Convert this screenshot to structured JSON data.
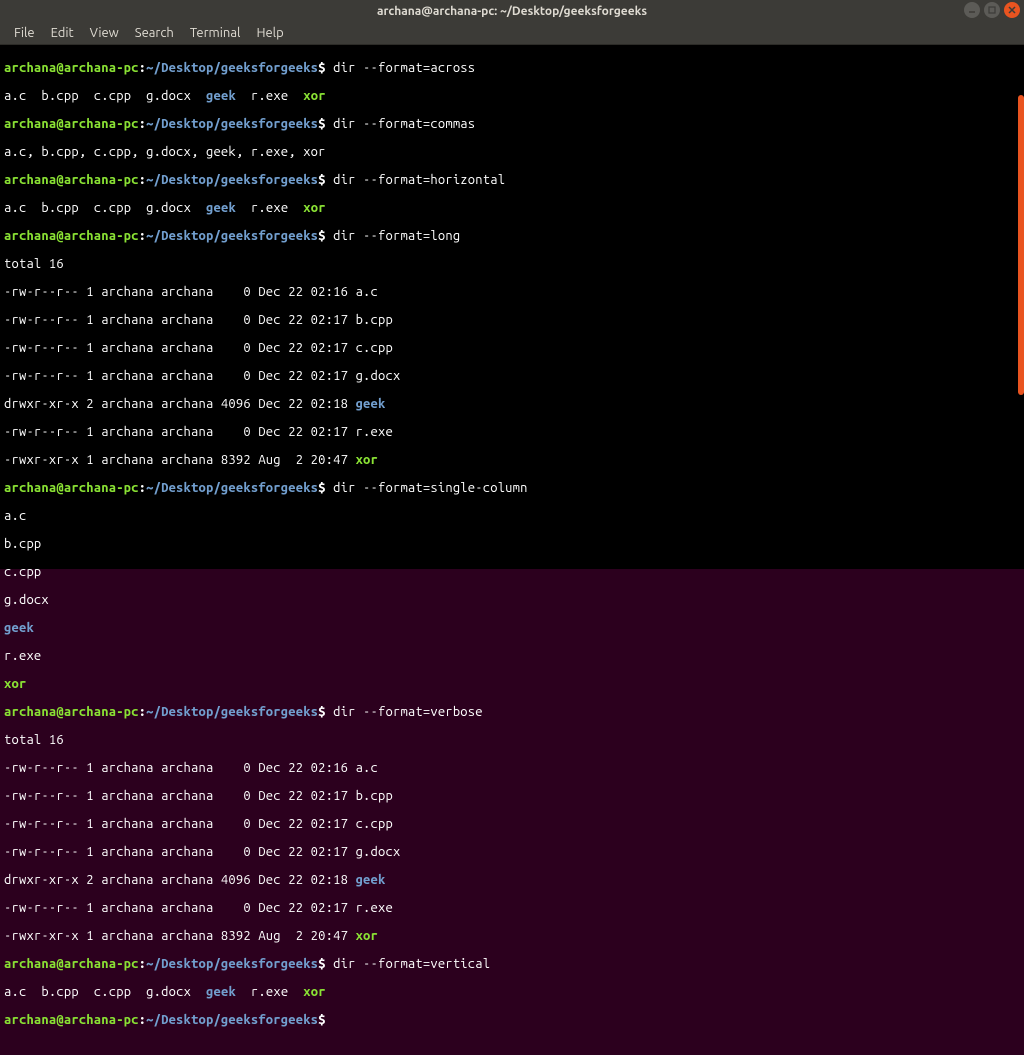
{
  "titlebar": {
    "title": "archana@archana-pc: ~/Desktop/geeksforgeeks"
  },
  "menubar": {
    "items": [
      "File",
      "Edit",
      "View",
      "Search",
      "Terminal",
      "Help"
    ]
  },
  "prompt": {
    "user_host": "archana@archana-pc",
    "colon": ":",
    "path": "~/Desktop/geeksforgeeks",
    "dollar": "$"
  },
  "commands": {
    "across": " dir --format=across",
    "commas": " dir --format=commas",
    "horizontal": " dir --format=horizontal",
    "long": " dir --format=long",
    "single": " dir --format=single-column",
    "verbose": " dir --format=verbose",
    "vertical": " dir --format=vertical",
    "empty": " "
  },
  "outputs": {
    "across_row": {
      "f1": "a.c",
      "f2": "b.cpp",
      "f3": "c.cpp",
      "f4": "g.docx",
      "f5": "geek",
      "f6": "r.exe",
      "f7": "xor"
    },
    "commas": "a.c, b.cpp, c.cpp, g.docx, geek, r.exe, xor",
    "total": "total 16",
    "long_rows": [
      {
        "perm": "-rw-r--r-- 1 archana archana    0 Dec 22 02:16 ",
        "name": "a.c",
        "type": "file"
      },
      {
        "perm": "-rw-r--r-- 1 archana archana    0 Dec 22 02:17 ",
        "name": "b.cpp",
        "type": "file"
      },
      {
        "perm": "-rw-r--r-- 1 archana archana    0 Dec 22 02:17 ",
        "name": "c.cpp",
        "type": "file"
      },
      {
        "perm": "-rw-r--r-- 1 archana archana    0 Dec 22 02:17 ",
        "name": "g.docx",
        "type": "file"
      },
      {
        "perm": "drwxr-xr-x 2 archana archana 4096 Dec 22 02:18 ",
        "name": "geek",
        "type": "dir"
      },
      {
        "perm": "-rw-r--r-- 1 archana archana    0 Dec 22 02:17 ",
        "name": "r.exe",
        "type": "file"
      },
      {
        "perm": "-rwxr-xr-x 1 archana archana 8392 Aug  2 20:47 ",
        "name": "xor",
        "type": "exe"
      }
    ],
    "single": [
      "a.c",
      "b.cpp",
      "c.cpp",
      "g.docx",
      "geek",
      "r.exe",
      "xor"
    ]
  }
}
